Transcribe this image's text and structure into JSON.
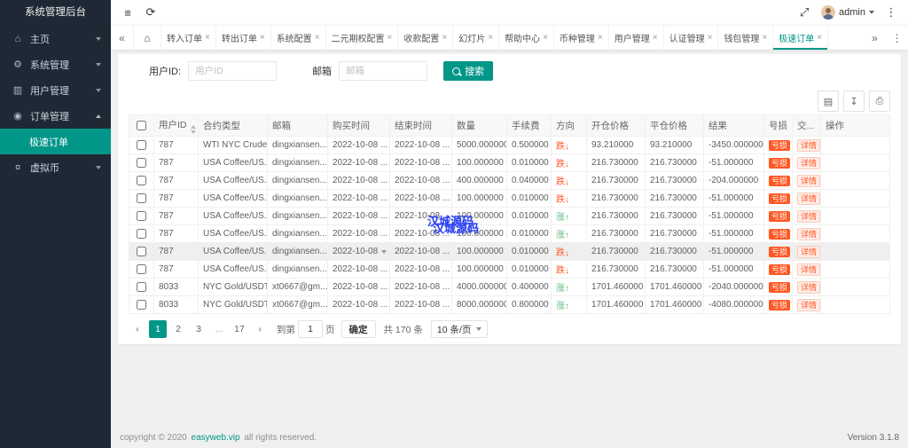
{
  "colors": {
    "accent": "#009688",
    "danger": "#ff5722",
    "success": "#5fb878",
    "sidebar_bg": "#1f2935",
    "watermark": "#2d43f3"
  },
  "sidebar": {
    "title": "系统管理后台",
    "items": [
      {
        "label": "主页"
      },
      {
        "label": "系统管理"
      },
      {
        "label": "用户管理"
      },
      {
        "label": "订单管理"
      },
      {
        "label": "虚拟币"
      }
    ],
    "active_item": "极速订单"
  },
  "topbar": {
    "username": "admin"
  },
  "icons": {
    "home": "⌂",
    "system": "⚙",
    "user": "▥",
    "order": "◉",
    "coin": "¤",
    "collapse": "≡",
    "refresh": "⟳",
    "fullscreen": "⤢",
    "more": "⋮",
    "tabs_left": "«",
    "tabs_right": "»",
    "tab_home": "⌂",
    "close": "×",
    "tool_columns": "▤",
    "tool_export": "↧",
    "tool_print": "⎙",
    "arrow_down": "↓",
    "arrow_up": "↑"
  },
  "tabs": {
    "items": [
      "转入订单",
      "转出订单",
      "系统配置",
      "二元期权配置",
      "收款配置",
      "幻灯片",
      "帮助中心",
      "币种管理",
      "用户管理",
      "认证管理",
      "钱包管理",
      "极速订单"
    ],
    "active": "极速订单"
  },
  "filters": {
    "user_id_label": "用户ID:",
    "user_id_placeholder": "用户ID",
    "email_label": "邮箱",
    "email_placeholder": "邮箱",
    "search_label": "搜索"
  },
  "table": {
    "headers": [
      "用户ID",
      "合约类型",
      "邮箱",
      "购买时间",
      "结束时间",
      "数量",
      "手续费",
      "方向",
      "开仓价格",
      "平仓价格",
      "结果",
      "号损",
      "交...",
      "操作"
    ],
    "badge_loss": "亏损",
    "badge_view": "详情",
    "rows": [
      {
        "id": "787",
        "type": "WTI NYC Crude...",
        "email": "dingxiansen...",
        "buy": "2022-10-08 ...",
        "end": "2022-10-08 ...",
        "qty": "5000.000000",
        "fee": "0.500000",
        "dir": "跌",
        "trend": "down",
        "open": "93.210000",
        "close": "93.210000",
        "result": "-3450.000000"
      },
      {
        "id": "787",
        "type": "USA Coffee/US...",
        "email": "dingxiansen...",
        "buy": "2022-10-08 ...",
        "end": "2022-10-08 ...",
        "qty": "100.000000",
        "fee": "0.010000",
        "dir": "跌",
        "trend": "down",
        "open": "216.730000",
        "close": "216.730000",
        "result": "-51.000000"
      },
      {
        "id": "787",
        "type": "USA Coffee/US...",
        "email": "dingxiansen...",
        "buy": "2022-10-08 ...",
        "end": "2022-10-08 ...",
        "qty": "400.000000",
        "fee": "0.040000",
        "dir": "跌",
        "trend": "down",
        "open": "216.730000",
        "close": "216.730000",
        "result": "-204.000000"
      },
      {
        "id": "787",
        "type": "USA Coffee/US...",
        "email": "dingxiansen...",
        "buy": "2022-10-08 ...",
        "end": "2022-10-08 ...",
        "qty": "100.000000",
        "fee": "0.010000",
        "dir": "跌",
        "trend": "down",
        "open": "216.730000",
        "close": "216.730000",
        "result": "-51.000000"
      },
      {
        "id": "787",
        "type": "USA Coffee/US...",
        "email": "dingxiansen...",
        "buy": "2022-10-08 ...",
        "end": "2022-10-08 ...",
        "qty": "100.000000",
        "fee": "0.010000",
        "dir": "涨",
        "trend": "up",
        "open": "216.730000",
        "close": "216.730000",
        "result": "-51.000000"
      },
      {
        "id": "787",
        "type": "USA Coffee/US...",
        "email": "dingxiansen...",
        "buy": "2022-10-08 ...",
        "end": "2022-10-08 ...",
        "qty": "100.000000",
        "fee": "0.010000",
        "dir": "涨",
        "trend": "up",
        "open": "216.730000",
        "close": "216.730000",
        "result": "-51.000000"
      },
      {
        "id": "787",
        "type": "USA Coffee/US...",
        "email": "dingxiansen...",
        "buy": "2022-10-08",
        "end": "2022-10-08 ...",
        "qty": "100.000000",
        "fee": "0.010000",
        "dir": "跌",
        "trend": "down",
        "open": "216.730000",
        "close": "216.730000",
        "result": "-51.000000",
        "hover": true,
        "select": true
      },
      {
        "id": "787",
        "type": "USA Coffee/US...",
        "email": "dingxiansen...",
        "buy": "2022-10-08 ...",
        "end": "2022-10-08 ...",
        "qty": "100.000000",
        "fee": "0.010000",
        "dir": "跌",
        "trend": "down",
        "open": "216.730000",
        "close": "216.730000",
        "result": "-51.000000"
      },
      {
        "id": "8033",
        "type": "NYC Gold/USDT...",
        "email": "xt0667@gm...",
        "buy": "2022-10-08 ...",
        "end": "2022-10-08 ...",
        "qty": "4000.000000",
        "fee": "0.400000",
        "dir": "涨",
        "trend": "up",
        "open": "1701.460000",
        "close": "1701.460000",
        "result": "-2040.000000"
      },
      {
        "id": "8033",
        "type": "NYC Gold/USDT...",
        "email": "xt0667@gm...",
        "buy": "2022-10-08 ...",
        "end": "2022-10-08 ...",
        "qty": "8000.000000",
        "fee": "0.800000",
        "dir": "涨",
        "trend": "up",
        "open": "1701.460000",
        "close": "1701.460000",
        "result": "-4080.000000"
      }
    ]
  },
  "pagination": {
    "prev": "‹",
    "next": "›",
    "pages": [
      "1",
      "2",
      "3",
      "...",
      "17"
    ],
    "active_page": "1",
    "jump_label": "到第",
    "jump_value": "1",
    "jump_unit": "页",
    "confirm_label": "确定",
    "total_label": "共 170 条",
    "limit_label": "10 条/页"
  },
  "watermark": {
    "text": "汉城源码"
  },
  "footer": {
    "copyright_prefix": "copyright © 2020 ",
    "link": "easyweb.vip",
    "copyright_suffix": " all rights reserved.",
    "version": "Version 3.1.8"
  }
}
